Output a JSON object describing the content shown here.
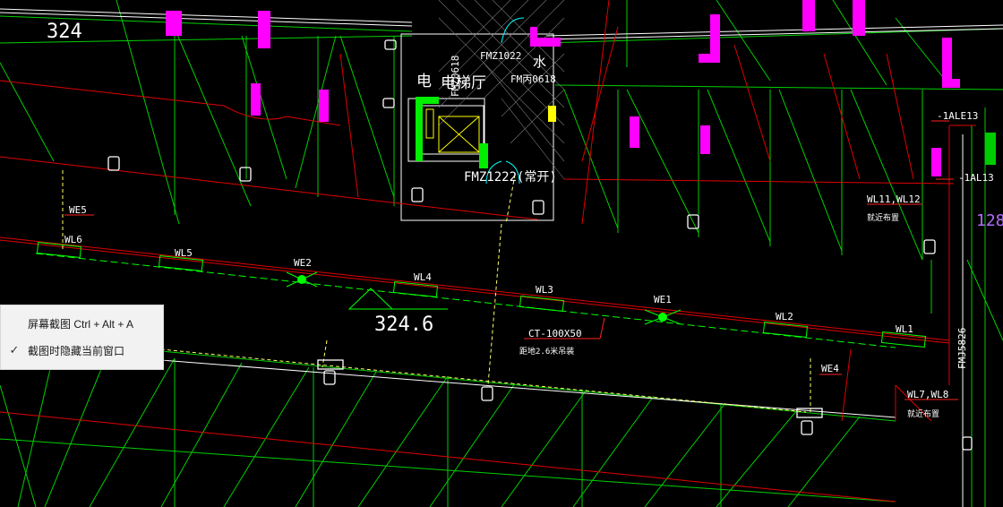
{
  "drawing": {
    "level_top": "324",
    "level_main": "324.6",
    "level_right": "128",
    "room_elevator": "电梯厅",
    "room_elec": "电",
    "room_water": "水",
    "door_fmz1022": "FMZ1022",
    "door_fmz0618_a": "FMZ0618",
    "door_fmz0618_b": "FM丙0618",
    "door_fmz1222": "FMZ1222(常开)",
    "door_fmj5826": "FMJ5826",
    "circuits": {
      "wl1": "WL1",
      "wl2": "WL2",
      "wl3": "WL3",
      "wl4": "WL4",
      "wl5": "WL5",
      "wl6": "WL6",
      "we1": "WE1",
      "we2": "WE2",
      "we4": "WE4",
      "we5": "WE5"
    },
    "panel_1ale13": "-1ALE13",
    "panel_1al13": "-1AL13",
    "note_wl11": "WL11,WL12",
    "note_wl11_sub": "就近布置",
    "note_wl7": "WL7,WL8",
    "note_wl7_sub": "就近布置",
    "tray_spec": "CT-100X50",
    "tray_note": "距地2.6米吊装"
  },
  "context_menu": {
    "item1": "屏幕截图 Ctrl + Alt + A",
    "item2": "截图时隐藏当前窗口",
    "item2_check": "✓"
  },
  "colors": {
    "background": "#000000",
    "line_green": "#00ff00",
    "line_red": "#ff0000",
    "line_white": "#ffffff",
    "line_yellow": "#ffff00",
    "line_magenta": "#ff00ff",
    "line_cyan": "#00ffff",
    "menu_bg": "#f2f2f2"
  }
}
